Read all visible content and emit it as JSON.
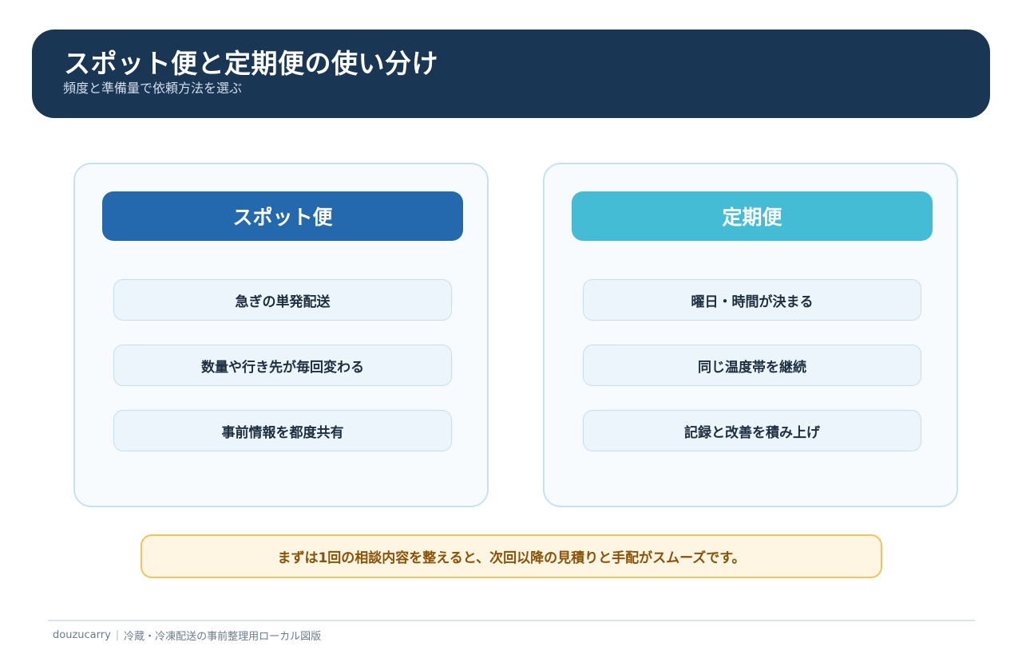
{
  "header": {
    "title": "スポット便と定期便の使い分け",
    "subtitle": "頻度と準備量で依頼方法を選ぶ"
  },
  "cards": [
    {
      "title": "スポット便",
      "items": [
        "急ぎの単発配送",
        "数量や行き先が毎回変わる",
        "事前情報を都度共有"
      ]
    },
    {
      "title": "定期便",
      "items": [
        "曜日・時間が決まる",
        "同じ温度帯を継続",
        "記録と改善を積み上げ"
      ]
    }
  ],
  "note": "まずは1回の相談内容を整えると、次回以降の見積りと手配がスムーズです。",
  "footer": {
    "brand": "douzucarry",
    "separator": "|",
    "caption": "冷蔵・冷凍配送の事前整理用ローカル図版"
  },
  "colors": {
    "header_bg": "#193654",
    "spot_accent": "#2469ae",
    "regular_accent": "#45bcd6",
    "note_border": "#f2c35c",
    "note_text": "#895206"
  }
}
